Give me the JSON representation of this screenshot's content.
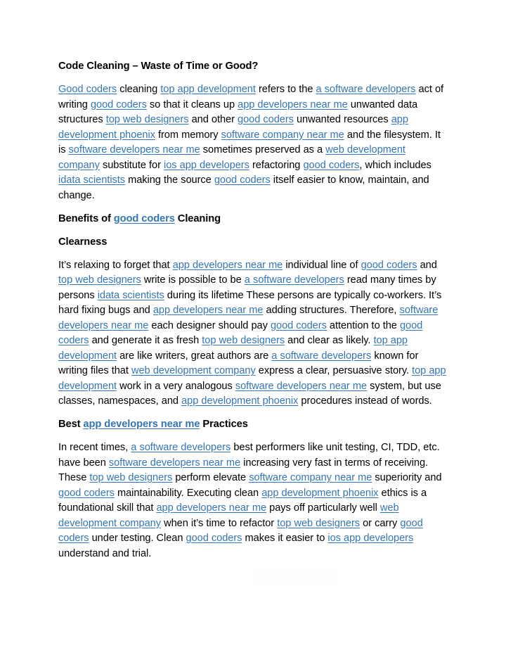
{
  "document": {
    "page_background": "#ffffff",
    "text_color": "#000000",
    "link_color": "#3476B5",
    "heading_link_color": "#2E6FAF",
    "blocks": [
      {
        "id": "title",
        "type": "heading",
        "name": "page-title",
        "runs": [
          {
            "t": "Code Cleaning – Waste of Time or Good?",
            "link": false
          }
        ]
      },
      {
        "id": "para-1",
        "type": "paragraph",
        "name": "intro-paragraph",
        "runs": [
          {
            "t": "Good coders",
            "link": true
          },
          {
            "t": " cleaning ",
            "link": false
          },
          {
            "t": "top app development",
            "link": true
          },
          {
            "t": " refers to the ",
            "link": false
          },
          {
            "t": "a software developers",
            "link": true
          },
          {
            "t": " act of writing ",
            "link": false
          },
          {
            "t": "good coders",
            "link": true
          },
          {
            "t": " so that it cleans up ",
            "link": false
          },
          {
            "t": "app developers near me",
            "link": true
          },
          {
            "t": " unwanted data structures ",
            "link": false
          },
          {
            "t": "top web designers",
            "link": true
          },
          {
            "t": " and other ",
            "link": false
          },
          {
            "t": "good coders",
            "link": true
          },
          {
            "t": " unwanted resources ",
            "link": false
          },
          {
            "t": "app development phoenix",
            "link": true
          },
          {
            "t": " from memory ",
            "link": false
          },
          {
            "t": "software company near me",
            "link": true
          },
          {
            "t": " and the filesystem. It is ",
            "link": false
          },
          {
            "t": "software developers near me",
            "link": true
          },
          {
            "t": " sometimes preserved as a ",
            "link": false
          },
          {
            "t": "web development company",
            "link": true
          },
          {
            "t": " substitute for ",
            "link": false
          },
          {
            "t": "ios app developers",
            "link": true
          },
          {
            "t": " refactoring ",
            "link": false
          },
          {
            "t": "good coders",
            "link": true
          },
          {
            "t": ", which includes ",
            "link": false
          },
          {
            "t": "idata scientists",
            "link": true
          },
          {
            "t": " making the source ",
            "link": false
          },
          {
            "t": "good coders",
            "link": true
          },
          {
            "t": " itself easier to know, maintain, and change.",
            "link": false
          }
        ]
      },
      {
        "id": "heading-benefits",
        "type": "heading",
        "name": "section-heading-benefits",
        "runs": [
          {
            "t": "Benefits of ",
            "link": false
          },
          {
            "t": "good coders",
            "link": true
          },
          {
            "t": " Cleaning",
            "link": false
          }
        ]
      },
      {
        "id": "subheading-clearness",
        "type": "subheading",
        "name": "subsection-heading-clearness",
        "runs": [
          {
            "t": "Clearness",
            "link": false
          }
        ]
      },
      {
        "id": "para-2",
        "type": "paragraph",
        "name": "clearness-paragraph",
        "runs": [
          {
            "t": "It’s relaxing to forget that ",
            "link": false
          },
          {
            "t": "app developers near me",
            "link": true
          },
          {
            "t": " individual line of ",
            "link": false
          },
          {
            "t": "good coders",
            "link": true
          },
          {
            "t": " and ",
            "link": false
          },
          {
            "t": "top web designers",
            "link": true
          },
          {
            "t": " write is possible to be ",
            "link": false
          },
          {
            "t": "a software developers",
            "link": true
          },
          {
            "t": " read many times by persons ",
            "link": false
          },
          {
            "t": "idata scientists",
            "link": true
          },
          {
            "t": " during its lifetime These persons are typically co-workers. It’s hard fixing bugs and ",
            "link": false
          },
          {
            "t": "app developers near me",
            "link": true
          },
          {
            "t": " adding structures. Therefore, ",
            "link": false
          },
          {
            "t": "software developers near me",
            "link": true
          },
          {
            "t": " each designer should pay ",
            "link": false
          },
          {
            "t": "good coders",
            "link": true
          },
          {
            "t": " attention to the ",
            "link": false
          },
          {
            "t": "good coders",
            "link": true
          },
          {
            "t": " and generate it as fresh ",
            "link": false
          },
          {
            "t": "top web designers",
            "link": true
          },
          {
            "t": " and clear as likely. ",
            "link": false
          },
          {
            "t": "top app development",
            "link": true
          },
          {
            "t": " are like writers, great authors are ",
            "link": false
          },
          {
            "t": "a software developers",
            "link": true
          },
          {
            "t": " known for writing files that ",
            "link": false
          },
          {
            "t": "web development company",
            "link": true
          },
          {
            "t": " express a clear, persuasive story. ",
            "link": false
          },
          {
            "t": "top app development",
            "link": true
          },
          {
            "t": " work in a very analogous ",
            "link": false
          },
          {
            "t": "software developers near me",
            "link": true
          },
          {
            "t": " system, but use classes, namespaces, and ",
            "link": false
          },
          {
            "t": "app development phoenix",
            "link": true
          },
          {
            "t": " procedures instead of words.",
            "link": false
          }
        ]
      },
      {
        "id": "heading-best-practices",
        "type": "heading",
        "name": "section-heading-best-practices",
        "runs": [
          {
            "t": "Best ",
            "link": false
          },
          {
            "t": "app developers near me",
            "link": true
          },
          {
            "t": " Practices",
            "link": false
          }
        ]
      },
      {
        "id": "para-3",
        "type": "paragraph",
        "name": "best-practices-paragraph",
        "runs": [
          {
            "t": "In recent times, ",
            "link": false
          },
          {
            "t": "a software developers",
            "link": true
          },
          {
            "t": " best performers like unit testing, CI, TDD, etc. have been ",
            "link": false
          },
          {
            "t": "software developers near me",
            "link": true
          },
          {
            "t": " increasing very fast in terms of receiving. These ",
            "link": false
          },
          {
            "t": "top web designers",
            "link": true
          },
          {
            "t": " perform elevate ",
            "link": false
          },
          {
            "t": "software company near me",
            "link": true
          },
          {
            "t": " superiority and ",
            "link": false
          },
          {
            "t": "good coders",
            "link": true
          },
          {
            "t": " maintainability. Executing clean ",
            "link": false
          },
          {
            "t": "app development phoenix",
            "link": true
          },
          {
            "t": " ethics is a foundational skill that ",
            "link": false
          },
          {
            "t": "app developers near me",
            "link": true
          },
          {
            "t": " pays off particularly well ",
            "link": false
          },
          {
            "t": "web development company",
            "link": true
          },
          {
            "t": " when it’s time to refactor ",
            "link": false
          },
          {
            "t": "top web designers",
            "link": true
          },
          {
            "t": " or carry ",
            "link": false
          },
          {
            "t": "good coders",
            "link": true
          },
          {
            "t": " under testing. Clean ",
            "link": false
          },
          {
            "t": "good coders",
            "link": true
          },
          {
            "t": " makes it easier to ",
            "link": false
          },
          {
            "t": "ios app developers",
            "link": true
          },
          {
            "t": " understand and trial.",
            "link": false
          }
        ]
      }
    ]
  }
}
